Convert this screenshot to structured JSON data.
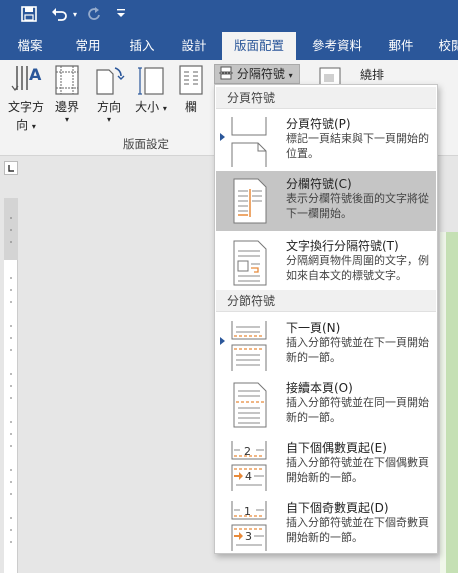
{
  "qat": {
    "save_icon": "save-icon",
    "undo_icon": "undo-icon",
    "redo_icon": "redo-icon",
    "customize_icon": "customize-qat-icon"
  },
  "tabs": [
    {
      "label": "檔案"
    },
    {
      "label": "常用"
    },
    {
      "label": "插入"
    },
    {
      "label": "設計"
    },
    {
      "label": "版面配置"
    },
    {
      "label": "參考資料"
    },
    {
      "label": "郵件"
    },
    {
      "label": "校閱"
    }
  ],
  "ribbon": {
    "text_direction": {
      "line1": "文字方",
      "line2": "向"
    },
    "margins": "邊界",
    "orientation": "方向",
    "size": "大小",
    "columns": "欄",
    "breaks_button": "分隔符號",
    "wrap_text": "繞排",
    "group_label": "版面設定"
  },
  "menu": {
    "section1": "分頁符號",
    "section2": "分節符號",
    "items": [
      {
        "title": "分頁符號(P)",
        "desc": "標記一頁結束與下一頁開始的位置。"
      },
      {
        "title": "分欄符號(C)",
        "desc": "表示分欄符號後面的文字將從下一欄開始。"
      },
      {
        "title": "文字換行分隔符號(T)",
        "desc": "分隔網頁物件周圍的文字，例如來自本文的標號文字。"
      },
      {
        "title": "下一頁(N)",
        "desc": "插入分節符號並在下一頁開始新的一節。"
      },
      {
        "title": "接續本頁(O)",
        "desc": "插入分節符號並在同一頁開始新的一節。"
      },
      {
        "title": "自下個偶數頁起(E)",
        "desc": "插入分節符號並在下個偶數頁開始新的一節。"
      },
      {
        "title": "自下個奇數頁起(D)",
        "desc": "插入分節符號並在下個奇數頁開始新的一節。"
      }
    ],
    "even_num_top": "2",
    "even_num_bottom": "4",
    "odd_num_top": "1",
    "odd_num_bottom": "3"
  },
  "colors": {
    "brand": "#2b579a",
    "accent_orange": "#e88a3a",
    "highlight": "#c5c5c5"
  }
}
